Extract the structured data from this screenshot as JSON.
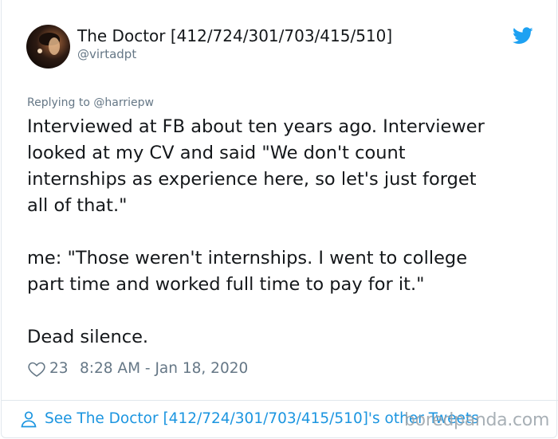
{
  "tweet": {
    "author_name": "The Doctor [412/724/301/703/415/510]",
    "author_handle": "@virtadpt",
    "replying_to": "Replying to @harriepw",
    "body_lines": [
      "Interviewed at FB about ten years ago. Interviewer",
      "looked at my CV and said \"We don't count",
      "internships as experience here, so let's just forget",
      "all of that.\"",
      "me: \"Those weren't internships. I went to college",
      "part time and worked full time to pay for it.\"",
      "Dead silence."
    ],
    "likes": "23",
    "timestamp": "8:28 AM - Jan 18, 2020",
    "more_tweets_link": "See The Doctor [412/724/301/703/415/510]'s other Tweets"
  },
  "watermark": "boredpanda.com",
  "colors": {
    "text": "#14171a",
    "secondary": "#657786",
    "link": "#1b95e0",
    "twitter_blue": "#1da1f2",
    "border": "#e1e8ed"
  },
  "icons": {
    "brand": "twitter-bird-icon",
    "like": "heart-icon",
    "profile": "person-icon"
  }
}
